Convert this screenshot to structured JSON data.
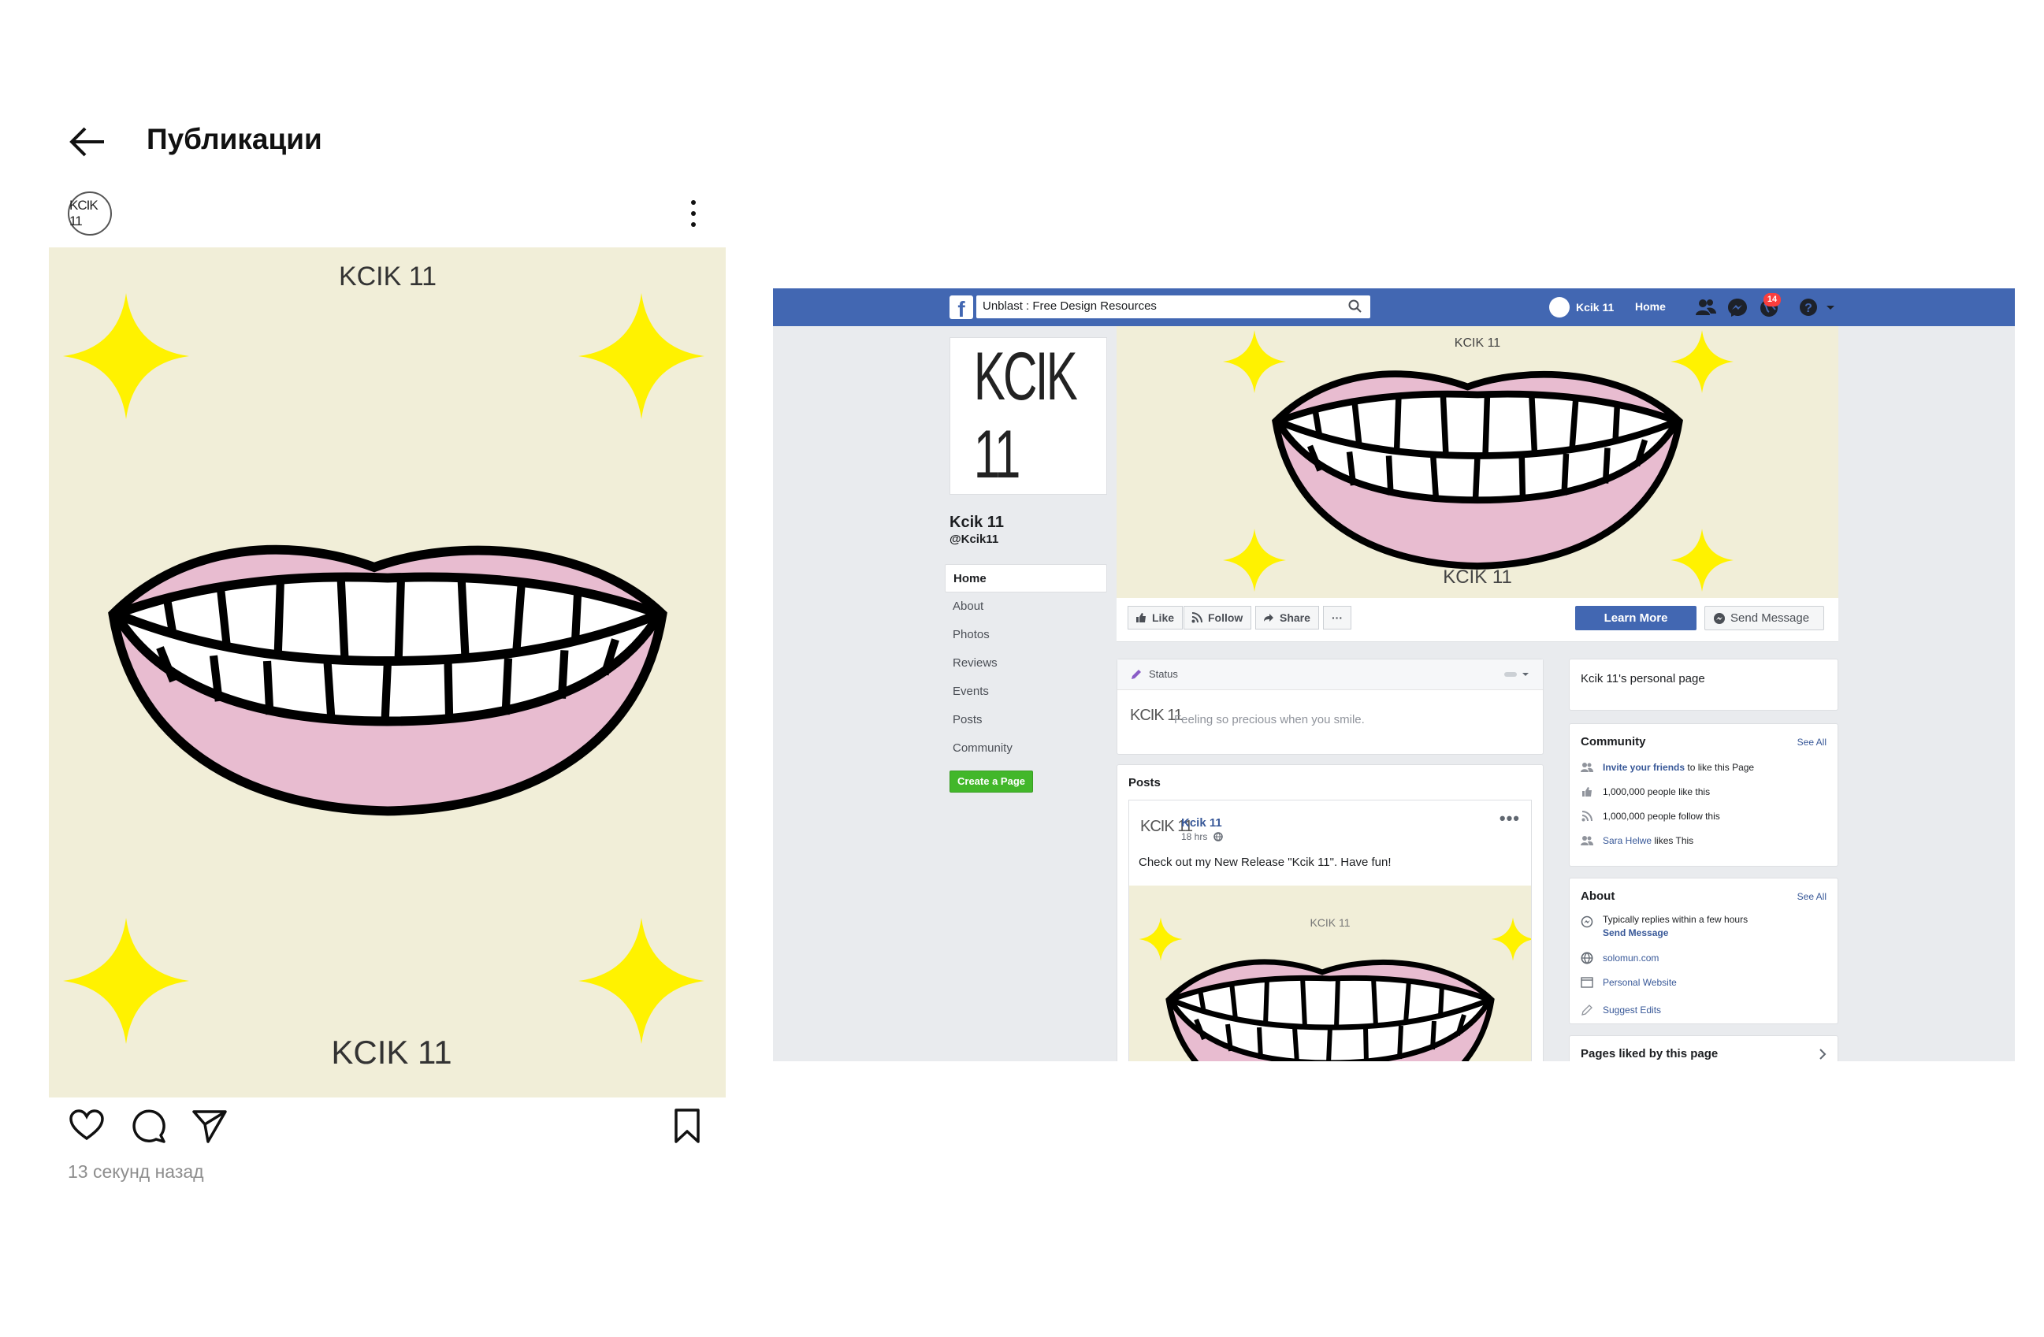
{
  "instagram": {
    "header_title": "Публикации",
    "avatar_text": "KCIK 11",
    "post_brand_top": "KCIK 11",
    "post_brand_bottom": "KCIK 11",
    "timestamp": "13 секунд назад"
  },
  "facebook": {
    "search_value": "Unblast : Free Design Resources",
    "user_name": "Kcik 11",
    "nav_home": "Home",
    "notification_count": "14",
    "profile_pic_text": "KCIK 11",
    "page_name": "Kcik 11",
    "page_handle": "@Kcik11",
    "left_nav": [
      "Home",
      "About",
      "Photos",
      "Reviews",
      "Events",
      "Posts",
      "Community"
    ],
    "create_page": "Create a Page",
    "cover_brand_top": "KCIK 11",
    "cover_brand_bottom": "KCIK 11",
    "actions": {
      "like": "Like",
      "follow": "Follow",
      "share": "Share",
      "more": "···",
      "learn_more": "Learn More",
      "send_message": "Send Message"
    },
    "status": {
      "label": "Status",
      "logo": "KCIK 11",
      "placeholder": "Feeling so precious when you smile."
    },
    "posts": {
      "title": "Posts",
      "author": "Kcik 11",
      "time": "18 hrs",
      "text": "Check out my New Release \"Kcik 11\". Have fun!",
      "logo": "KCIK 11",
      "image_brand": "KCIK 11",
      "more": "•••"
    },
    "personal_page": "Kcik 11's personal page",
    "community": {
      "title": "Community",
      "see_all": "See All",
      "invite_link": "Invite your friends",
      "invite_rest": "to like this Page",
      "likes": "1,000,000 people like this",
      "follows": "1,000,000 people follow this",
      "friend_name": "Sara Helwe",
      "friend_rest": "likes This"
    },
    "about": {
      "title": "About",
      "see_all": "See All",
      "replies": "Typically replies within a few hours",
      "send_message": "Send Message",
      "website": "solomun.com",
      "personal_website": "Personal Website",
      "suggest_edits": "Suggest Edits"
    },
    "pages_liked": "Pages liked by this page",
    "colors": {
      "brand_blue": "#4267b2",
      "link": "#385898",
      "green": "#42b72a",
      "cream": "#f1eed8",
      "lip_pink": "#e8bcd0",
      "star_yellow": "#fff200"
    }
  }
}
